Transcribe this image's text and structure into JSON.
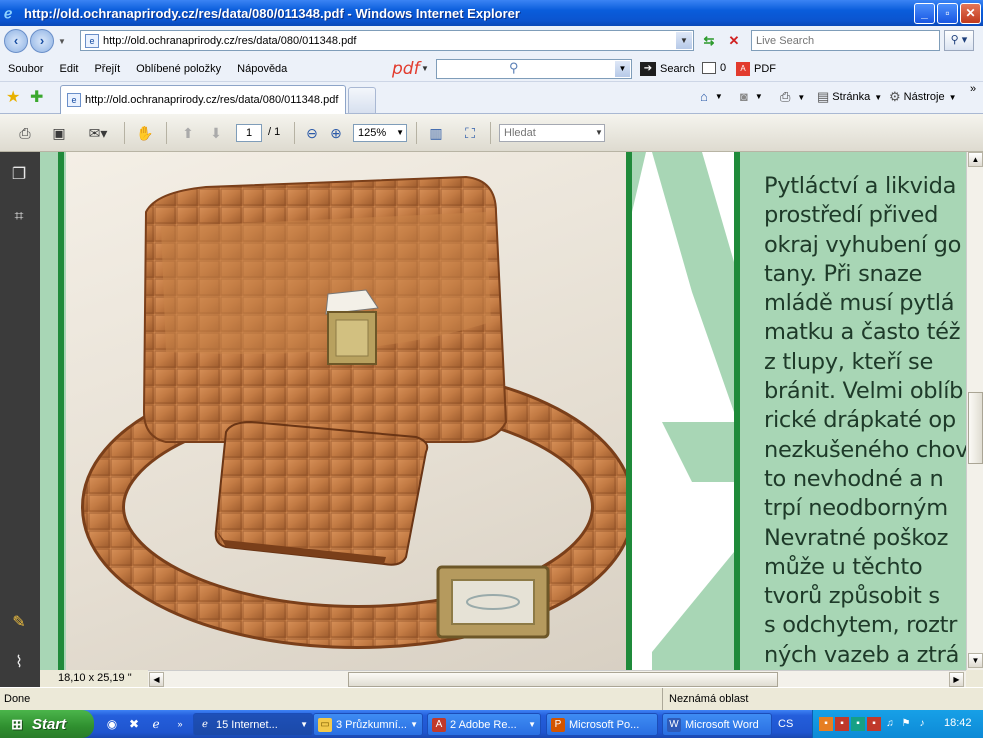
{
  "window": {
    "title": "http://old.ochranaprirody.cz/res/data/080/011348.pdf - Windows Internet Explorer"
  },
  "address": {
    "url": "http://old.ochranaprirody.cz/res/data/080/011348.pdf",
    "search_placeholder": "Live Search"
  },
  "menu": {
    "items": [
      "Soubor",
      "Edit",
      "Přejít",
      "Oblíbené položky",
      "Nápověda"
    ]
  },
  "toolbar": {
    "search_label": "Search",
    "mail_count": "0",
    "pdf_label": "PDF"
  },
  "tab": {
    "label": "http://old.ochranaprirody.cz/res/data/080/011348.pdf"
  },
  "commands": {
    "page_label": "Stránka",
    "tools_label": "Nástroje",
    "more": "»"
  },
  "reader": {
    "page_current": "1",
    "page_total": "/ 1",
    "zoom": "125%",
    "find_placeholder": "Hledat"
  },
  "document": {
    "lines": [
      "Pytláctví a likvida",
      "prostředí  přived",
      "okraj vyhubení go",
      "tany.  Při  snaze",
      "mládě musí pytlá",
      "matku a často též",
      "z  tlupy,  kteří  se",
      "bránit. Velmi oblíb",
      "rické drápkaté op",
      "nezkušeného chov",
      "to nevhodné a n",
      "trpí  neodborným",
      "Nevratné  poškoz",
      "může  u  těchto",
      "tvorů  způsobit  s",
      "s odchytem, roztr",
      "ných vazeb a ztrá"
    ],
    "page_size": "18,10 x 25,19 \""
  },
  "status": {
    "left": "Done",
    "zone": "Neznámá oblast"
  },
  "taskbar": {
    "start": "Start",
    "tasks": [
      "15 Internet...",
      "3 Průzkumní...",
      "2 Adobe Re...",
      "Microsoft Po...",
      "Microsoft Word"
    ],
    "language": "CS",
    "time": "18:42"
  },
  "colors": {
    "doc_green": "#a8d6b5",
    "accent_green": "#1f8a3a",
    "text_dark": "#1e3a29"
  }
}
